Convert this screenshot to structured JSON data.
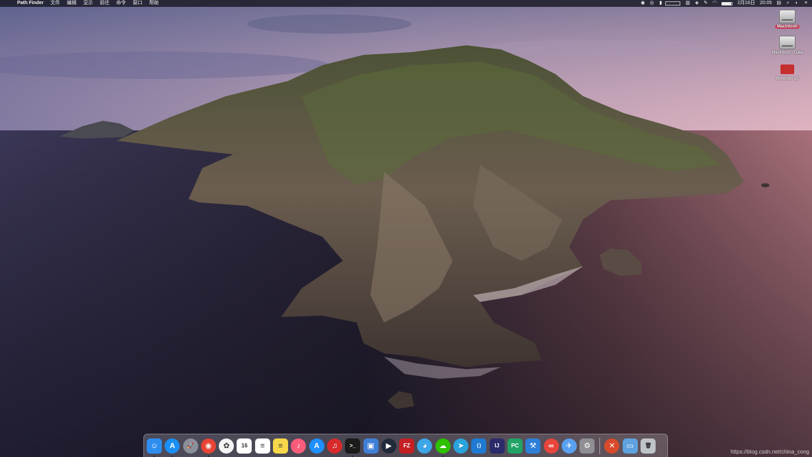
{
  "menubar": {
    "app_name": "Path Finder",
    "menus": [
      "文件",
      "编辑",
      "显示",
      "前往",
      "命令",
      "窗口",
      "帮助"
    ],
    "date": "2月16日",
    "time": "20:05",
    "battery_level": 0.9,
    "status_icons": [
      "wechat-icon",
      "alarm-icon",
      "bookmark-icon",
      "network-stats-icon",
      "cpu-stats-icon",
      "app-status-icon",
      "wifi-icon",
      "tools-icon",
      "notification-icon",
      "search-icon",
      "siri-icon",
      "menu-list-icon"
    ]
  },
  "desktop": {
    "items": [
      {
        "label": "Macintosh",
        "sub": "",
        "selected": true,
        "icon": "hard-drive-icon"
      },
      {
        "label": "Macintosh - Data",
        "sub": "",
        "selected": false,
        "icon": "hard-drive-icon"
      },
      {
        "label": "Windows 10",
        "sub": "",
        "selected": false,
        "icon": "windows-drive-icon"
      }
    ]
  },
  "dock": {
    "apps": [
      {
        "name": "Finder",
        "icon": "finder-icon",
        "color": "#2d8ef0",
        "glyph": "☺",
        "running": true
      },
      {
        "name": "App Store",
        "icon": "app-store-icon",
        "color": "#1a8ff5",
        "glyph": "A",
        "running": true,
        "round": true
      },
      {
        "name": "Launchpad",
        "icon": "launchpad-icon",
        "color": "#8b8f99",
        "glyph": "🚀",
        "running": false,
        "round": true
      },
      {
        "name": "Chrome",
        "icon": "chrome-icon",
        "color": "#e84335",
        "glyph": "◉",
        "running": true,
        "round": true
      },
      {
        "name": "Photos",
        "icon": "photos-icon",
        "color": "#f4f4f4",
        "glyph": "✿",
        "running": false,
        "round": true
      },
      {
        "name": "Calendar",
        "icon": "calendar-icon",
        "color": "#ffffff",
        "glyph": "16",
        "running": false
      },
      {
        "name": "Reminders",
        "icon": "reminders-icon",
        "color": "#ffffff",
        "glyph": "≡",
        "running": false
      },
      {
        "name": "Notes",
        "icon": "notes-icon",
        "color": "#f6d84a",
        "glyph": "≡",
        "running": false
      },
      {
        "name": "Music",
        "icon": "music-icon",
        "color": "#fa5c7a",
        "glyph": "♪",
        "running": false,
        "round": true
      },
      {
        "name": "App Store",
        "icon": "app-store-blue-icon",
        "color": "#1e90ff",
        "glyph": "A",
        "running": false,
        "round": true
      },
      {
        "name": "NetEase Music",
        "icon": "netease-music-icon",
        "color": "#d82a2a",
        "glyph": "♫",
        "running": false,
        "round": true
      },
      {
        "name": "Terminal",
        "icon": "terminal-icon",
        "color": "#1b1b1b",
        "glyph": ">_",
        "running": true
      },
      {
        "name": "Remote Desktop",
        "icon": "remote-desktop-icon",
        "color": "#3f7fd6",
        "glyph": "▣",
        "running": false
      },
      {
        "name": "QuickTime",
        "icon": "quicktime-icon",
        "color": "#222a3a",
        "glyph": "▶",
        "running": false,
        "round": true
      },
      {
        "name": "FileZilla",
        "icon": "filezilla-icon",
        "color": "#c42024",
        "glyph": "FZ",
        "running": false
      },
      {
        "name": "QQ",
        "icon": "qq-icon",
        "color": "#3da6e8",
        "glyph": "◕",
        "running": false,
        "round": true
      },
      {
        "name": "WeChat",
        "icon": "wechat-icon",
        "color": "#2dc100",
        "glyph": "☁",
        "running": true,
        "round": true
      },
      {
        "name": "Telegram",
        "icon": "telegram-icon",
        "color": "#2aa3dd",
        "glyph": "➤",
        "running": false,
        "round": true
      },
      {
        "name": "VS Code",
        "icon": "vscode-icon",
        "color": "#1f7ad1",
        "glyph": "⟨⟩",
        "running": false
      },
      {
        "name": "IntelliJ IDEA",
        "icon": "intellij-icon",
        "color": "#2b2b6b",
        "glyph": "IJ",
        "running": false
      },
      {
        "name": "PyCharm",
        "icon": "pycharm-icon",
        "color": "#21a366",
        "glyph": "PC",
        "running": false
      },
      {
        "name": "Xcode",
        "icon": "xcode-icon",
        "color": "#2d7fd8",
        "glyph": "⚒",
        "running": false
      },
      {
        "name": "Creative Cloud",
        "icon": "creative-cloud-icon",
        "color": "#e8453c",
        "glyph": "∞",
        "running": false,
        "round": true
      },
      {
        "name": "Migration",
        "icon": "migration-icon",
        "color": "#5aa0f0",
        "glyph": "✈",
        "running": false,
        "round": true
      },
      {
        "name": "System Preferences",
        "icon": "system-preferences-icon",
        "color": "#8e8e93",
        "glyph": "⚙",
        "running": false
      }
    ],
    "extras": [
      {
        "name": "Remote Desktop",
        "icon": "microsoft-remote-desktop-icon",
        "color": "#d84a2a",
        "glyph": "✕",
        "running": false,
        "round": true
      },
      {
        "name": "Applications",
        "icon": "applications-folder-icon",
        "color": "#5fa2e0",
        "glyph": "▭",
        "running": false
      },
      {
        "name": "Trash",
        "icon": "trash-icon",
        "color": "#bfc4c8",
        "glyph": "🗑",
        "running": false
      }
    ]
  },
  "watermark": "https://blog.csdn.net/china_cong"
}
